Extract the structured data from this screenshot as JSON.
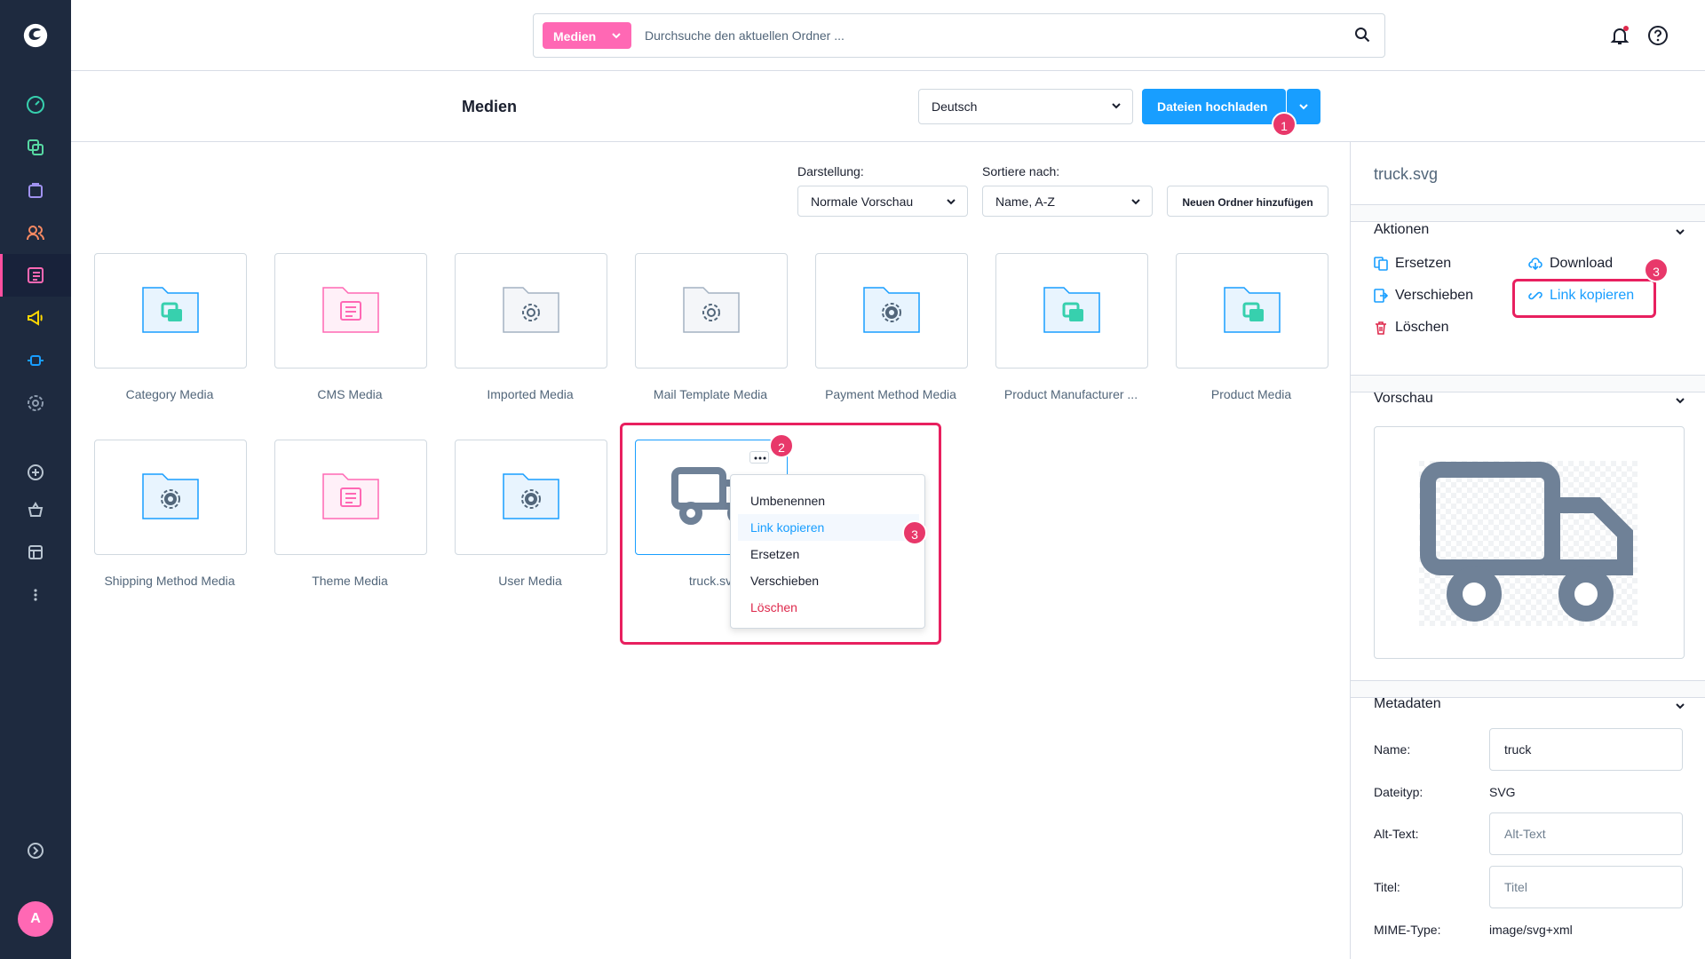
{
  "search": {
    "scope_label": "Medien",
    "placeholder": "Durchsuche den aktuellen Ordner ..."
  },
  "header": {
    "title": "Medien",
    "language": "Deutsch",
    "upload_label": "Dateien hochladen"
  },
  "toolbar": {
    "display_label": "Darstellung:",
    "display_value": "Normale Vorschau",
    "sort_label": "Sortiere nach:",
    "sort_value": "Name, A-Z",
    "new_folder_label": "Neuen Ordner hinzufügen"
  },
  "folders": [
    {
      "name": "Category Media",
      "icon": "product-folder-icon",
      "color": "#189eff"
    },
    {
      "name": "CMS Media",
      "icon": "cms-folder-icon",
      "color": "#ff68b4"
    },
    {
      "name": "Imported Media",
      "icon": "settings-folder-icon",
      "color": "#52667a"
    },
    {
      "name": "Mail Template Media",
      "icon": "settings-folder-icon",
      "color": "#52667a"
    },
    {
      "name": "Payment Method Media",
      "icon": "settings-folder-icon",
      "color": "#189eff"
    },
    {
      "name": "Product Manufacturer ...",
      "icon": "product-folder-icon",
      "color": "#189eff"
    },
    {
      "name": "Product Media",
      "icon": "product-folder-icon",
      "color": "#189eff"
    },
    {
      "name": "Shipping Method Media",
      "icon": "settings-folder-icon",
      "color": "#189eff"
    },
    {
      "name": "Theme Media",
      "icon": "cms-folder-icon",
      "color": "#ff68b4"
    },
    {
      "name": "User Media",
      "icon": "settings-folder-icon",
      "color": "#189eff"
    }
  ],
  "file": {
    "name": "truck.svg",
    "label_visible": "truck.sv"
  },
  "context_menu": {
    "items": [
      "Umbenennen",
      "Link kopieren",
      "Ersetzen",
      "Verschieben",
      "Löschen"
    ]
  },
  "annotations": {
    "b1": "1",
    "b2": "2",
    "b3a": "3",
    "b3b": "3"
  },
  "sidebar_icons": [
    "dashboard-icon",
    "catalogue-icon",
    "orders-icon",
    "customers-icon",
    "content-icon",
    "marketing-icon",
    "extensions-icon",
    "settings-icon",
    "add-icon",
    "basket-icon",
    "store-icon",
    "more-icon",
    "expand-icon"
  ],
  "user": {
    "initial": "A"
  },
  "right_panel": {
    "filename": "truck.svg",
    "actions_title": "Aktionen",
    "actions": {
      "replace": "Ersetzen",
      "download": "Download",
      "move": "Verschieben",
      "copy_link": "Link kopieren",
      "delete": "Löschen"
    },
    "preview_title": "Vorschau",
    "metadata_title": "Metadaten",
    "meta": {
      "name_label": "Name:",
      "name_value": "truck",
      "type_label": "Dateityp:",
      "type_value": "SVG",
      "alt_label": "Alt-Text:",
      "alt_placeholder": "Alt-Text",
      "title_label": "Titel:",
      "title_placeholder": "Titel",
      "mime_label": "MIME-Type:",
      "mime_value": "image/svg+xml"
    }
  },
  "colors": {
    "sidebar": "#1e2a3f",
    "primary": "#189eff",
    "brand_pink": "#ff68b4",
    "annotation": "#e8205f",
    "danger": "#de294c"
  }
}
